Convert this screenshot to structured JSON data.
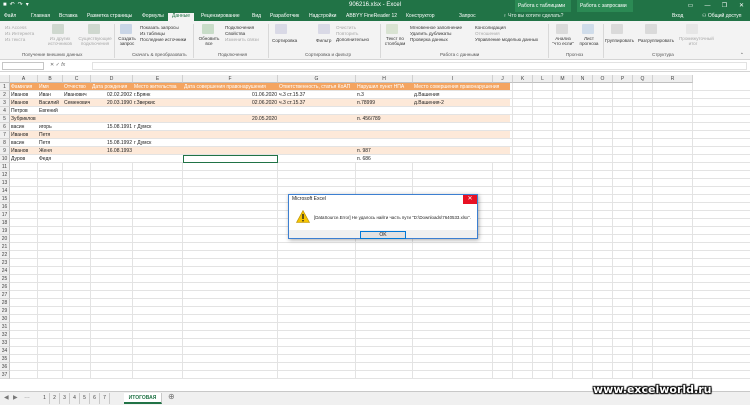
{
  "window": {
    "title": "906216.xlsx - Excel",
    "quick_access": [
      "save",
      "undo",
      "redo",
      "more"
    ],
    "context_tab_groups": [
      "Работа с таблицами",
      "Работа с запросами"
    ],
    "controls": [
      "—",
      "❐",
      "✕"
    ]
  },
  "tabs": [
    "Файл",
    "Главная",
    "Вставка",
    "Разметка страницы",
    "Формулы",
    "Данные",
    "Рецензирование",
    "Вид",
    "Разработчик",
    "Надстройки",
    "ABBYY FineReader 12",
    "Конструктор",
    "Запрос"
  ],
  "active_tab": "Данные",
  "tell_me": "Что вы хотите сделать?",
  "account": {
    "login": "Вход",
    "share": "Общий доступ"
  },
  "ribbon": {
    "external": {
      "items": [
        "Из Access",
        "Из Интернета",
        "Из текста"
      ],
      "other": "Из других источников",
      "existing": "Существующие подключения",
      "group": "Получение внешних данных"
    },
    "transform": {
      "new_query": "Создать запрос",
      "items": [
        "Показать запросы",
        "Из таблицы",
        "Последние источники"
      ],
      "group": "Скачать & преобразовать"
    },
    "connections": {
      "refresh": "Обновить все",
      "items": [
        "Подключения",
        "Свойства",
        "Изменить связи"
      ],
      "group": "Подключения"
    },
    "sort": {
      "sort": "Сортировка",
      "filter": "Фильтр",
      "items": [
        "Очистить",
        "Повторить",
        "Дополнительно"
      ],
      "group": "Сортировка и фильтр"
    },
    "data_tools": {
      "text_cols": "Текст по столбцам",
      "items": [
        "Мгновенное заполнение",
        "Удалить дубликаты",
        "Проверка данных"
      ],
      "items2": [
        "Консолидация",
        "Отношения",
        "Управление моделью данных"
      ],
      "group": "Работа с данными"
    },
    "forecast": {
      "whatif": "Анализ \"что если\"",
      "sheet": "Лист прогноза",
      "group": "Прогноз"
    },
    "outline": {
      "group_btn": "Группировать",
      "ungroup": "Разгруппировать",
      "subtotal": "Промежуточный итог",
      "group": "Структура"
    }
  },
  "formula_bar": {
    "name_box": "",
    "fx": "fx",
    "value": ""
  },
  "columns": [
    "A",
    "B",
    "C",
    "D",
    "E",
    "F",
    "G",
    "H",
    "I",
    "J",
    "K",
    "L",
    "M",
    "N",
    "O",
    "P",
    "Q",
    "R"
  ],
  "table_header": [
    "Фамилия",
    "Имя",
    "Отчество",
    "Дата рождения",
    "Место жительства",
    "Дата совершения правонарушения",
    "Ответственность, статья КоАП",
    "Нарушил пункт НПА",
    "Место совершения правонарушения"
  ],
  "rows": [
    [
      "Иванов",
      "Иван",
      "Иванович",
      "02.02.2002",
      "г.Брянк",
      "01.06.2020",
      "ч.3 ст.15.37",
      "п.3",
      "д.Вашения"
    ],
    [
      "Иванов",
      "Василий",
      "Семенович",
      "20.03.1990",
      "г.Зверкис",
      "02.06.2020",
      "ч.3 ст.15.37",
      "п.78999",
      "д.Вашения-2"
    ],
    [
      "Петров",
      "Евгений",
      "",
      "",
      "",
      "",
      "",
      "",
      ""
    ],
    [
      "Зубриклов",
      "",
      "",
      "",
      "",
      "20.05.2020",
      "",
      "п. 456/789",
      ""
    ],
    [
      "васин",
      "игорь",
      "",
      "15.08.1991",
      "г Думск",
      "",
      "",
      "",
      ""
    ],
    [
      "Иванов",
      "Петя",
      "",
      "",
      "",
      "",
      "",
      "",
      ""
    ],
    [
      "васин",
      "Петя",
      "",
      "15.08.1992",
      "г Думск",
      "",
      "",
      "",
      ""
    ],
    [
      "Иванов",
      "Женя",
      "",
      "16.08.1993",
      "",
      "",
      "",
      "п. 987",
      ""
    ],
    [
      "Дуров",
      "Федя",
      "",
      "",
      "",
      "",
      "",
      "п. 686",
      ""
    ]
  ],
  "row_numbers": [
    "1",
    "2",
    "3",
    "4",
    "5",
    "6",
    "7",
    "8",
    "9",
    "10",
    "11",
    "12",
    "13",
    "14",
    "15",
    "16",
    "17",
    "18",
    "19",
    "20",
    "21",
    "22",
    "23",
    "24",
    "25",
    "26",
    "27",
    "28",
    "29",
    "30",
    "31",
    "32",
    "33",
    "34",
    "35",
    "36",
    "37"
  ],
  "sheets": [
    "1",
    "2",
    "3",
    "4",
    "5",
    "6",
    "7",
    "ИТОГОВАЯ"
  ],
  "active_sheet": "ИТОГОВАЯ",
  "dialog": {
    "title": "Microsoft Excel",
    "message": "[DataSource.Error] Не удалось найти часть пути \"D:\\Downloads\\7640533.xlsx\".",
    "ok": "OK",
    "icon": "warning-icon"
  },
  "watermark": "www.excelworld.ru",
  "colors": {
    "excel_green": "#217346",
    "header_orange": "#f4a460",
    "band": "#fde9d9"
  }
}
